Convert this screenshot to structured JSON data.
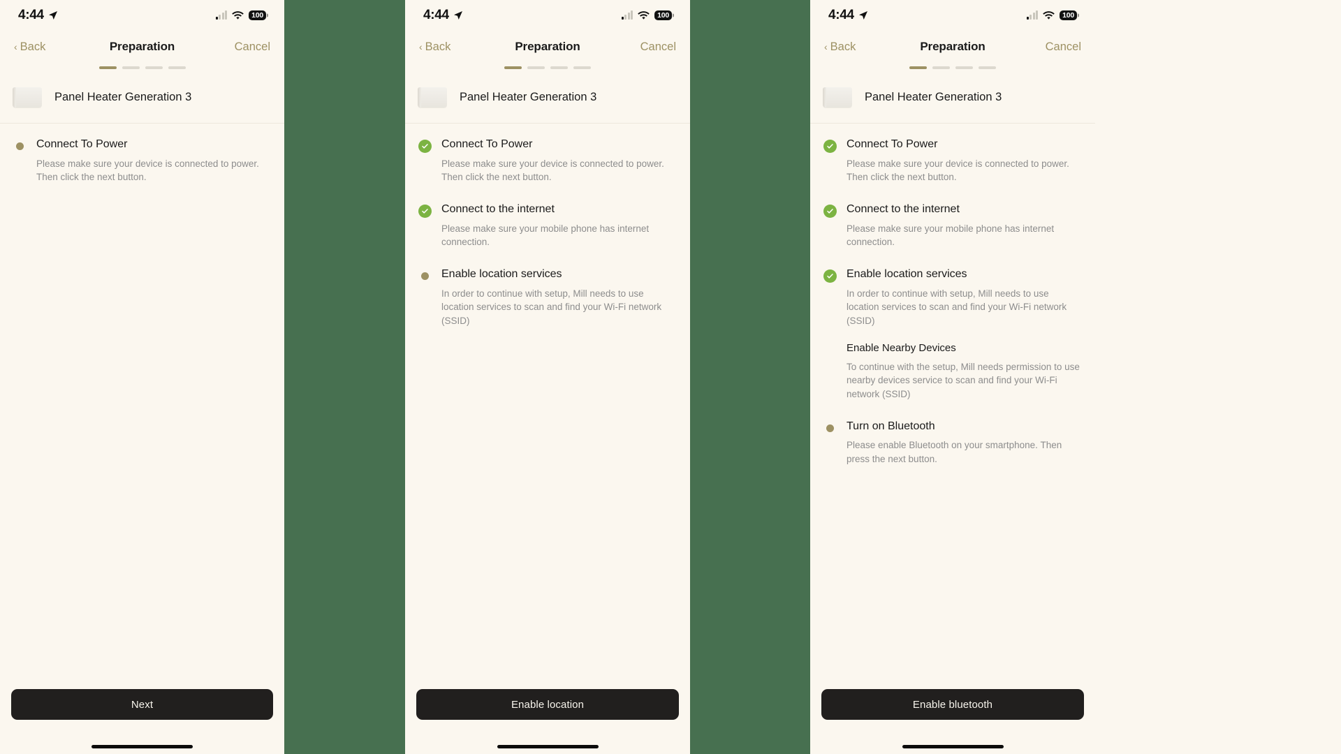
{
  "theme": {
    "background_green": "#477050",
    "screen_bg": "#FBF7EF",
    "accent_tan": "#9D9163",
    "check_green": "#7CB342",
    "cta_dark": "#211F1E",
    "body_text": "#8D8D8D"
  },
  "status_bar": {
    "time": "4:44",
    "battery_level": "100",
    "location_icon": "location-arrow-icon",
    "cellular_icon": "cellular-bars-icon",
    "wifi_icon": "wifi-icon"
  },
  "nav": {
    "back_label": "Back",
    "title": "Preparation",
    "cancel_label": "Cancel",
    "total_steps": 4,
    "active_step": 1
  },
  "device": {
    "name": "Panel Heater Generation 3",
    "thumb_icon": "panel-heater-thumbnail"
  },
  "items": {
    "power": {
      "title": "Connect To Power",
      "desc": "Please make sure your device is connected to power. Then click the next button."
    },
    "internet": {
      "title": "Connect to the internet",
      "desc": "Please  make sure your mobile phone has internet connection."
    },
    "location": {
      "title": "Enable location services",
      "desc": "In order to continue with setup, Mill needs to use location services to scan and find your Wi-Fi network (SSID)"
    },
    "nearby": {
      "title": "Enable Nearby Devices",
      "desc": "To continue with the setup, Mill needs permission to use nearby devices service to scan and find your Wi-Fi network (SSID)"
    },
    "bluetooth": {
      "title": "Turn on Bluetooth",
      "desc": "Please enable Bluetooth on your smartphone. Then press the next button."
    }
  },
  "panels": {
    "one": {
      "cta_label": "Next"
    },
    "two": {
      "cta_label": "Enable location"
    },
    "three": {
      "cta_label": "Enable bluetooth"
    }
  }
}
